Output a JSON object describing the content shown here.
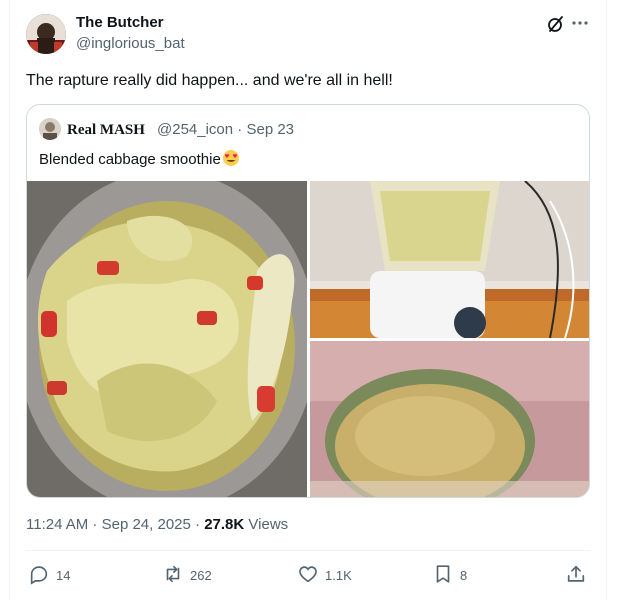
{
  "tweet": {
    "author": {
      "name": "The Butcher",
      "handle": "@inglorious_bat"
    },
    "text": "The rapture really did happen... and we're all in hell!",
    "quoted": {
      "author": {
        "name": "Real MASH",
        "handle": "@254_icon"
      },
      "date": "Sep 23",
      "text": "Blended cabbage smoothie",
      "emoji": "heart-eyes-emoji"
    },
    "time": "11:24 AM",
    "date": "Sep 24, 2025",
    "views_count": "27.8K",
    "views_label": "Views"
  },
  "actions": {
    "replies": "14",
    "retweets": "262",
    "likes": "1.1K",
    "bookmarks": "8"
  },
  "icons": [
    "grok-icon",
    "more-icon",
    "reply-icon",
    "retweet-icon",
    "like-icon",
    "bookmark-icon",
    "share-icon"
  ],
  "colors": {
    "secondary_text": "#536471",
    "border": "#cfd9de",
    "text": "#0f1419"
  }
}
